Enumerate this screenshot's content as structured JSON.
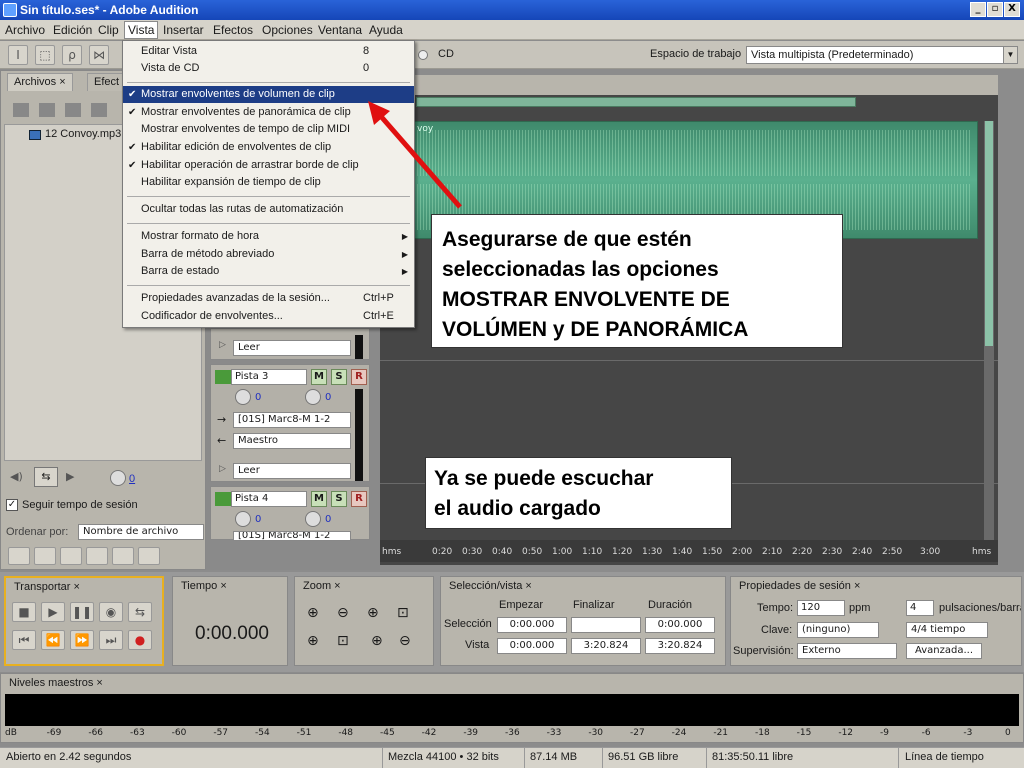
{
  "window": {
    "title": "Sin título.ses* - Adobe Audition",
    "min": "_",
    "max": "▫",
    "close": "X"
  },
  "menubar": [
    "Archivo",
    "Edición",
    "Clip",
    "Vista",
    "Insertar",
    "Efectos",
    "Opciones",
    "Ventana",
    "Ayuda"
  ],
  "toolbar": {
    "cd_label": "CD",
    "workspace_label": "Espacio de trabajo",
    "workspace_value": "Vista multipista (Predeterminado)"
  },
  "left_panel": {
    "tabs": [
      "Archivos",
      "Efect"
    ],
    "file": "12 Convoy.mp3",
    "follow_label": "Seguir tempo de sesión",
    "sort_label": "Ordenar por:",
    "sort_value": "Nombre de archivo",
    "vol_value": "0"
  },
  "tracks": [
    {
      "read": "Leer"
    },
    {
      "name": "Pista 3",
      "vol": "0",
      "pan": "0",
      "input": "[01S] Marc8-M 1-2",
      "output": "Maestro",
      "read": "Leer"
    },
    {
      "name": "Pista 4",
      "vol": "0",
      "pan": "0",
      "input": "[01S] Marc8-M 1-2"
    }
  ],
  "buttons_msr": [
    "M",
    "S",
    "R"
  ],
  "editor": {
    "clip_label": "voy",
    "ruler": [
      "hms",
      "0:20",
      "0:30",
      "0:40",
      "0:50",
      "1:00",
      "1:10",
      "1:20",
      "1:30",
      "1:40",
      "1:50",
      "2:00",
      "2:10",
      "2:20",
      "2:30",
      "2:40",
      "2:50",
      "3:00",
      "hms"
    ]
  },
  "menu": {
    "items": [
      {
        "label": "Editar Vista",
        "shortcut": "8"
      },
      {
        "label": "Vista de CD",
        "shortcut": "0"
      },
      {
        "label": "Mostrar envolventes de volumen de clip",
        "checked": true,
        "highlight": true
      },
      {
        "label": "Mostrar envolventes de panorámica de clip",
        "checked": true
      },
      {
        "label": "Mostrar envolventes de tempo de clip MIDI"
      },
      {
        "label": "Habilitar edición de envolventes de clip",
        "checked": true
      },
      {
        "label": "Habilitar operación de arrastrar borde de clip",
        "checked": true
      },
      {
        "label": "Habilitar expansión de tiempo de clip"
      },
      {
        "label": "Ocultar todas las rutas de automatización"
      },
      {
        "label": "Mostrar formato de hora",
        "submenu": true
      },
      {
        "label": "Barra de método abreviado",
        "submenu": true
      },
      {
        "label": "Barra de estado",
        "submenu": true
      },
      {
        "label": "Propiedades avanzadas de la sesión...",
        "shortcut": "Ctrl+P"
      },
      {
        "label": "Codificador de envolventes...",
        "shortcut": "Ctrl+E"
      }
    ]
  },
  "callouts": {
    "main": [
      "Asegurarse de que estén",
      "seleccionadas las opciones",
      "MOSTRAR ENVOLVENTE DE",
      "VOLÚMEN y DE PANORÁMICA"
    ],
    "second": [
      "Ya se puede escuchar",
      "el audio cargado"
    ]
  },
  "transport": {
    "title": "Transportar"
  },
  "time": {
    "title": "Tiempo",
    "value": "0:00.000"
  },
  "zoom": {
    "title": "Zoom"
  },
  "selection": {
    "title": "Selección/vista",
    "headers": [
      "Empezar",
      "Finalizar",
      "Duración"
    ],
    "rows": [
      {
        "label": "Selección",
        "values": [
          "0:00.000",
          "",
          "0:00.000"
        ]
      },
      {
        "label": "Vista",
        "values": [
          "0:00.000",
          "3:20.824",
          "3:20.824"
        ]
      }
    ]
  },
  "session": {
    "title": "Propiedades de sesión",
    "tempo_label": "Tempo:",
    "tempo_value": "120",
    "tempo_unit": "ppm",
    "beats_value": "4",
    "beats_unit": "pulsaciones/barra",
    "key_label": "Clave:",
    "key_value": "(ninguno)",
    "sig_value": "4/4 tiempo",
    "sup_label": "Supervisión:",
    "sup_value": "Externo",
    "adv_label": "Avanzada..."
  },
  "levels": {
    "title": "Niveles maestros",
    "scale": [
      "dB",
      "-69",
      "-66",
      "-63",
      "-60",
      "-57",
      "-54",
      "-51",
      "-48",
      "-45",
      "-42",
      "-39",
      "-36",
      "-33",
      "-30",
      "-27",
      "-24",
      "-21",
      "-18",
      "-15",
      "-12",
      "-9",
      "-6",
      "-3",
      "0"
    ]
  },
  "status": {
    "opened": "Abierto en 2.42 segundos",
    "mix": "Mezcla 44100 • 32 bits",
    "size": "87.14 MB",
    "free": "96.51 GB libre",
    "time_free": "81:35:50.11 libre",
    "timeline": "Línea de tiempo"
  },
  "colors": {
    "accent": "#1d3d86",
    "arrow": "#e01010",
    "wave": "#4f9e7c",
    "title": "#1546b8"
  }
}
